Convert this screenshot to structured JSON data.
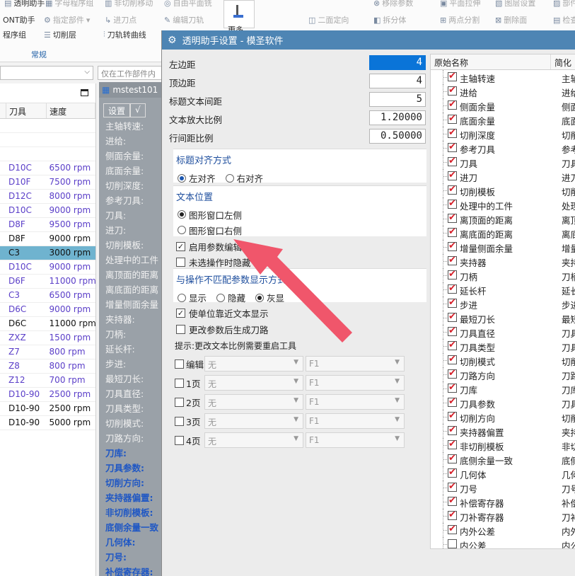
{
  "ribbon": {
    "row1": [
      "透明助手",
      "字母程序组",
      "非切削移动",
      "自由平面铣",
      "移除参数",
      "平面拉伸",
      "图层设置",
      "部件"
    ],
    "row2": [
      "ONT助手",
      "指定部件",
      "进刀点",
      "编辑刀轨",
      "二面定向",
      "拆分体",
      "两点分割",
      "删除面",
      "检查"
    ],
    "row3": [
      "程序组",
      "切削层",
      "刀轨转曲线",
      "超级工具栏",
      "定向"
    ],
    "more_label": "更多",
    "group_label": "常规"
  },
  "filterbar": {
    "combo1_arrow": "⌵",
    "combo2_placeholder": "仅在工作部件内"
  },
  "left_table": {
    "columns": [
      "刀具",
      "速度"
    ],
    "rows": [
      {
        "tool": "D10C",
        "speed": "6500 rpm",
        "style": "purple"
      },
      {
        "tool": "D10F",
        "speed": "7500 rpm",
        "style": "purple"
      },
      {
        "tool": "D12C",
        "speed": "8000 rpm",
        "style": "purple"
      },
      {
        "tool": "D10C",
        "speed": "9000 rpm",
        "style": "purple"
      },
      {
        "tool": "D8F",
        "speed": "9500 rpm",
        "style": "purple"
      },
      {
        "tool": "D8F",
        "speed": "9000 rpm",
        "style": "blk"
      },
      {
        "tool": "C3",
        "speed": "3000 rpm",
        "style": "sel"
      },
      {
        "tool": "D10C",
        "speed": "9000 rpm",
        "style": "purple"
      },
      {
        "tool": "D6F",
        "speed": "11000 rpm",
        "style": "purple"
      },
      {
        "tool": "C3",
        "speed": "6500 rpm",
        "style": "purple"
      },
      {
        "tool": "D6C",
        "speed": "9000 rpm",
        "style": "purple"
      },
      {
        "tool": "D6C",
        "speed": "11000 rpm",
        "style": "blk"
      },
      {
        "tool": "ZXZ",
        "speed": "1500 rpm",
        "style": "purple"
      },
      {
        "tool": "Z7",
        "speed": "800 rpm",
        "style": "purple"
      },
      {
        "tool": "Z8",
        "speed": "800 rpm",
        "style": "purple"
      },
      {
        "tool": "Z12",
        "speed": "700 rpm",
        "style": "purple"
      },
      {
        "tool": "D10-90",
        "speed": "2500 rpm",
        "style": "purple"
      },
      {
        "tool": "D10-90",
        "speed": "2500 rpm",
        "style": "blk"
      },
      {
        "tool": "D10-90",
        "speed": "5000 rpm",
        "style": "blk"
      }
    ]
  },
  "mid_panel": {
    "title": "mstest101",
    "tab_settings": "设置",
    "tab_check": "√",
    "lines": [
      "主轴转速:",
      "进给:",
      "侧面余量:",
      "底面余量:",
      "切削深度:",
      "参考刀具:",
      "刀具:",
      "进刀:",
      "切削模板:",
      "处理中的工件",
      "离顶面的距离",
      "离底面的距离",
      "增量侧面余量",
      "夹持器:",
      "刀柄:",
      "延长杆:",
      "步进:",
      "最短刀长:",
      "刀具直径:",
      "刀具类型:",
      "切削模式:",
      "刀路方向:"
    ],
    "blue_lines": [
      "刀库:",
      "刀具参数:",
      "切削方向:",
      "夹持器偏置:",
      "非切削模板:",
      "底侧余量一致",
      "几何体:",
      "刀号:",
      "补偿寄存器:"
    ]
  },
  "dialog": {
    "title": "透明助手设置 - 模圣软件",
    "fields": [
      {
        "label": "左边距",
        "value": "4",
        "selected": true
      },
      {
        "label": "顶边距",
        "value": "4",
        "selected": false
      },
      {
        "label": "标题文本间距",
        "value": "5",
        "selected": false
      },
      {
        "label": "文本放大比例",
        "value": "1.20000",
        "selected": false
      },
      {
        "label": "行间距比例",
        "value": "0.50000",
        "selected": false
      }
    ],
    "title_align": {
      "title": "标题对齐方式",
      "left": "左对齐",
      "right": "右对齐"
    },
    "text_pos": {
      "title": "文本位置",
      "left": "图形窗口左侧",
      "right": "图形窗口右侧"
    },
    "enable_edit": "启用参数编辑",
    "hide_unselected": "未选操作时隐藏",
    "mismatch": {
      "title": "与操作不匹配参数显示方式",
      "show": "显示",
      "hide": "隐藏",
      "gray": "灰显"
    },
    "unit_near": "使单位靠近文本显示",
    "regen_path": "更改参数后生成刀路",
    "hint": "提示:更改文本比例需要重启工具",
    "pages": [
      {
        "label": "编辑",
        "a": "无",
        "b": "F1"
      },
      {
        "label": "1页",
        "a": "无",
        "b": "F1"
      },
      {
        "label": "2页",
        "a": "无",
        "b": "F1"
      },
      {
        "label": "3页",
        "a": "无",
        "b": "F1"
      },
      {
        "label": "4页",
        "a": "无",
        "b": "F1"
      }
    ],
    "list_header": {
      "name": "原始名称",
      "short": "简化"
    },
    "list": [
      {
        "name": "主轴转速",
        "short": "主轴",
        "checked": true
      },
      {
        "name": "进给",
        "short": "进给",
        "checked": true
      },
      {
        "name": "侧面余量",
        "short": "侧面",
        "checked": true
      },
      {
        "name": "底面余量",
        "short": "底面",
        "checked": true
      },
      {
        "name": "切削深度",
        "short": "切削",
        "checked": true
      },
      {
        "name": "参考刀具",
        "short": "参考",
        "checked": true
      },
      {
        "name": "刀具",
        "short": "刀具",
        "checked": true
      },
      {
        "name": "进刀",
        "short": "进刀",
        "checked": true
      },
      {
        "name": "切削模板",
        "short": "切削",
        "checked": true
      },
      {
        "name": "处理中的工件",
        "short": "处理",
        "checked": true
      },
      {
        "name": "离顶面的距离",
        "short": "离顶",
        "checked": true
      },
      {
        "name": "离底面的距离",
        "short": "离底",
        "checked": true
      },
      {
        "name": "增量侧面余量",
        "short": "增量",
        "checked": true
      },
      {
        "name": "夹持器",
        "short": "夹持",
        "checked": true
      },
      {
        "name": "刀柄",
        "short": "刀柄",
        "checked": true
      },
      {
        "name": "延长杆",
        "short": "延长",
        "checked": true
      },
      {
        "name": "步进",
        "short": "步进",
        "checked": true
      },
      {
        "name": "最短刀长",
        "short": "最短",
        "checked": true
      },
      {
        "name": "刀具直径",
        "short": "刀具",
        "checked": true
      },
      {
        "name": "刀具类型",
        "short": "刀具",
        "checked": true
      },
      {
        "name": "切削模式",
        "short": "切削",
        "checked": true
      },
      {
        "name": "刀路方向",
        "short": "刀路",
        "checked": true
      },
      {
        "name": "刀库",
        "short": "刀库",
        "checked": true
      },
      {
        "name": "刀具参数",
        "short": "刀具",
        "checked": true
      },
      {
        "name": "切削方向",
        "short": "切削",
        "checked": true
      },
      {
        "name": "夹持器偏置",
        "short": "夹持",
        "checked": true
      },
      {
        "name": "非切削模板",
        "short": "非切",
        "checked": true
      },
      {
        "name": "底侧余量一致",
        "short": "底侧",
        "checked": true
      },
      {
        "name": "几何体",
        "short": "几何",
        "checked": true
      },
      {
        "name": "刀号",
        "short": "刀号",
        "checked": true
      },
      {
        "name": "补偿寄存器",
        "short": "补偿",
        "checked": true
      },
      {
        "name": "刀补寄存器",
        "short": "刀补",
        "checked": true
      },
      {
        "name": "内外公差",
        "short": "内外",
        "checked": true
      },
      {
        "name": "内公差",
        "short": "内公",
        "checked": false
      }
    ]
  },
  "colors": {
    "accent": "#4e85b4",
    "arrow": "#f0566b",
    "selection": "#0a74d8"
  }
}
